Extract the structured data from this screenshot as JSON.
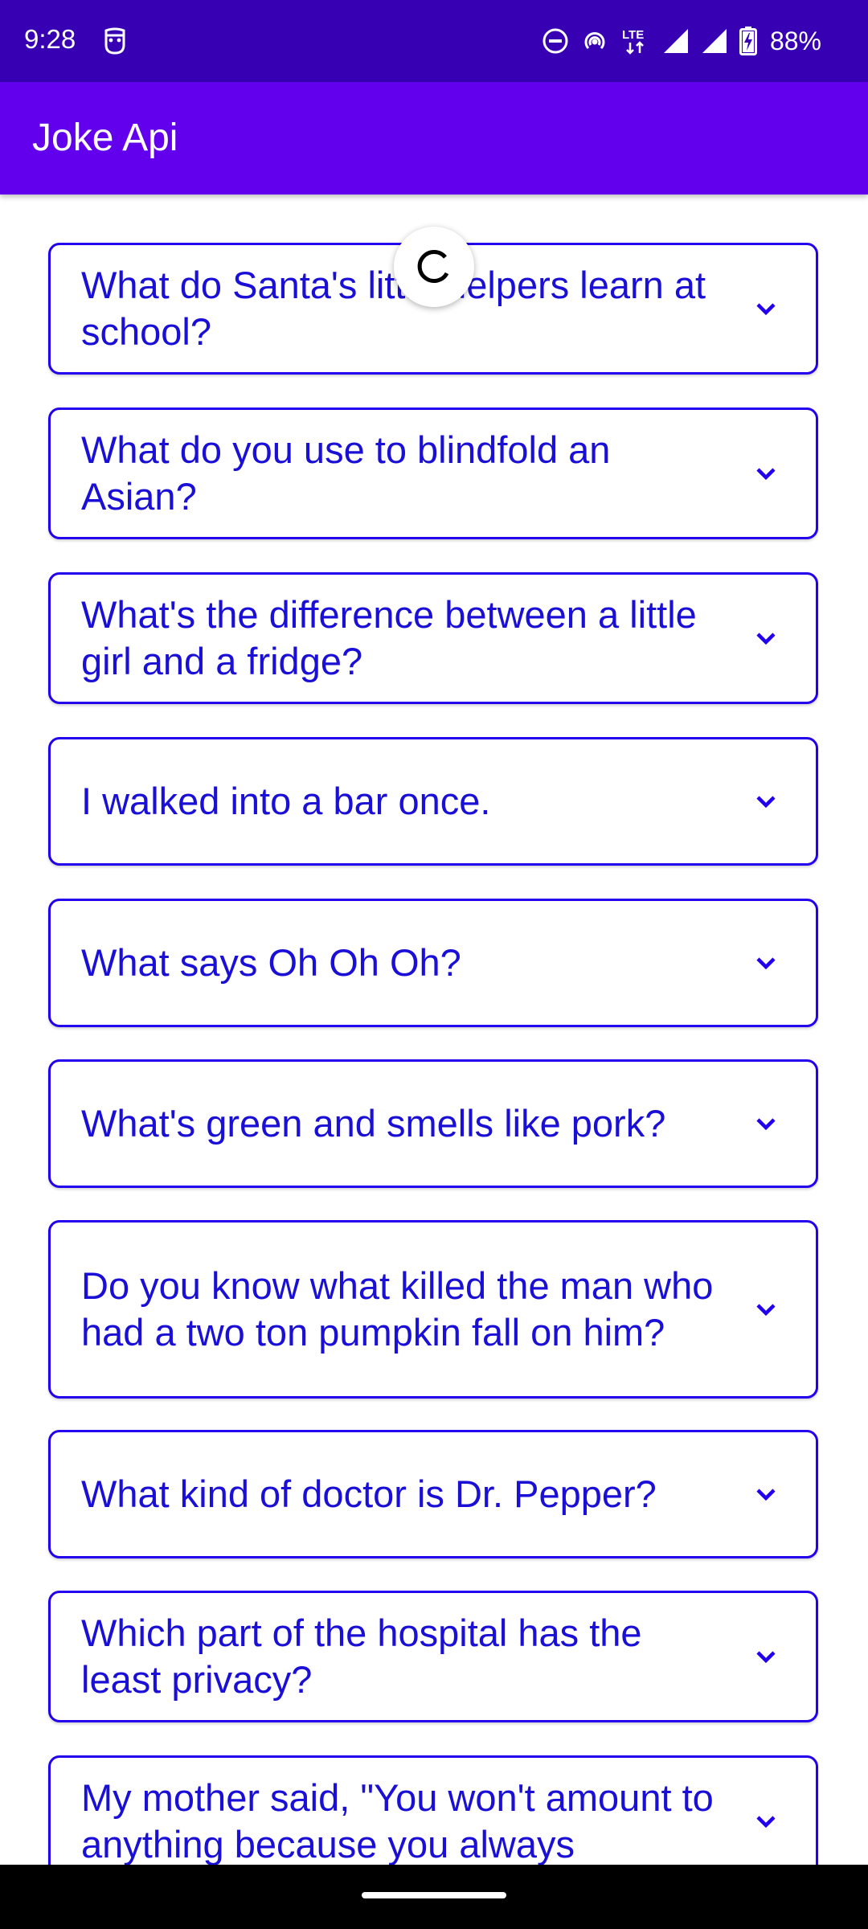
{
  "status_bar": {
    "time": "9:28",
    "network": "LTE",
    "battery_percent": "88%",
    "icons": [
      "notification-app-icon",
      "do-not-disturb-icon",
      "hotspot-icon",
      "lte-data-icon",
      "wifi-signal-icon",
      "cell-signal-icon",
      "battery-charging-icon"
    ]
  },
  "app_bar": {
    "title": "Joke Api"
  },
  "jokes": [
    {
      "setup": "What do Santa's little helpers learn at school?"
    },
    {
      "setup": "What do you use to blindfold an Asian?"
    },
    {
      "setup": "What's the difference between a little girl and a fridge?"
    },
    {
      "setup": "I walked into a bar once."
    },
    {
      "setup": "What says Oh Oh Oh?"
    },
    {
      "setup": "What's green and smells like pork?"
    },
    {
      "setup": "Do you know what killed the man who had a two ton pumpkin fall on him?"
    },
    {
      "setup": "What kind of doctor is Dr. Pepper?"
    },
    {
      "setup": "Which part of the hospital has the least privacy?"
    },
    {
      "setup": "My mother said, \"You won't amount to anything because you always"
    }
  ],
  "expand_icon": "chevron-down-icon",
  "refresh_icon": "refresh-spinner-icon",
  "colors": {
    "status_bar": "#3700b3",
    "app_bar": "#6200ee",
    "card_border": "#2200ee",
    "card_text": "#1a0fd6"
  }
}
